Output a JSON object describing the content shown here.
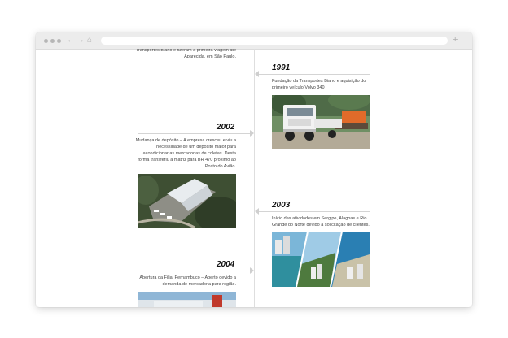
{
  "browser": {
    "nav_back": "←",
    "nav_forward": "→",
    "home": "⌂",
    "new_tab": "+",
    "menu": "⋮"
  },
  "timeline": {
    "top_partial_text": "Transportes Biano e fizeram a primeira viagem até Aparecida, em São Paulo.",
    "entries": [
      {
        "year": "1991",
        "text": "Fundação da Transportes Biano e aquisição do primeiro veículo Volvo 340",
        "image": "truck-photo"
      },
      {
        "year": "2002",
        "text": "Mudança de depósito – A empresa cresceu e viu a necessidade de um depósito maior para acondicionar as mercadorias de coletas. Desta forma transferiu a matriz para BR 470 próximo ao Posto do Avião.",
        "image": "warehouse-aerial-photo"
      },
      {
        "year": "2003",
        "text": "Início das atividades em Sergipe, Alagoas e Rio Grande do Norte devido a solicitação de clientes.",
        "image": "coastal-cities-collage"
      },
      {
        "year": "2004",
        "text": "Abertura da Filial Pernambuco – Aberto devido a demanda de mercadoria para região.",
        "image": "branch-building-photo"
      }
    ]
  },
  "colors": {
    "axis": "#dedede",
    "separator": "#d4d4d4",
    "marker": "#cfcfcf",
    "year_text": "#111111",
    "body_text": "#444444"
  }
}
